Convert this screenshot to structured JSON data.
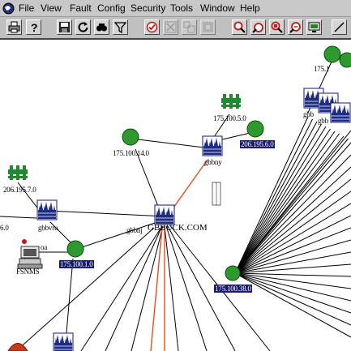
{
  "menubar": {
    "items": [
      "File",
      "View",
      "Fault",
      "Config",
      "Security",
      "Tools",
      "Window",
      "Help"
    ]
  },
  "toolbar": {
    "buttons": [
      "print-icon",
      "help-icon",
      "save-icon",
      "refresh-icon",
      "find-icon",
      "filter-icon",
      "acknowledge-icon",
      "clear-icon",
      "group-icon",
      "layout-icon",
      "zoom-in-icon",
      "zoom-out-icon",
      "zoom-fit-icon",
      "search-zoom-icon",
      "monitor-icon"
    ]
  },
  "map": {
    "labels": {
      "n175_100_14_0": "175.100.14.0",
      "n175_100_5_0": "175.100.5.0",
      "n206_195_6_0": "206.195.6.0",
      "gbbny": "gbbny",
      "n206_195_7_0": "206.195.7.0",
      "gbbvru": "gbbvru",
      "gbbnj": "gbbnj",
      "gbbuck": "GBBUCK.COM",
      "left_edge": "6.0",
      "coa": "oa",
      "fsnms": "FSNMS",
      "n175_100_1_0": "175.100.1.0",
      "n175_100_38_0": "175.100.38.0",
      "right_top": "175.1",
      "right_gbb1": "gbb",
      "right_gbb2": "gbb"
    },
    "colors": {
      "node_green": "#2e9a2e",
      "link_red": "#e0501e",
      "selected_bg": "#1a1a6e"
    }
  }
}
